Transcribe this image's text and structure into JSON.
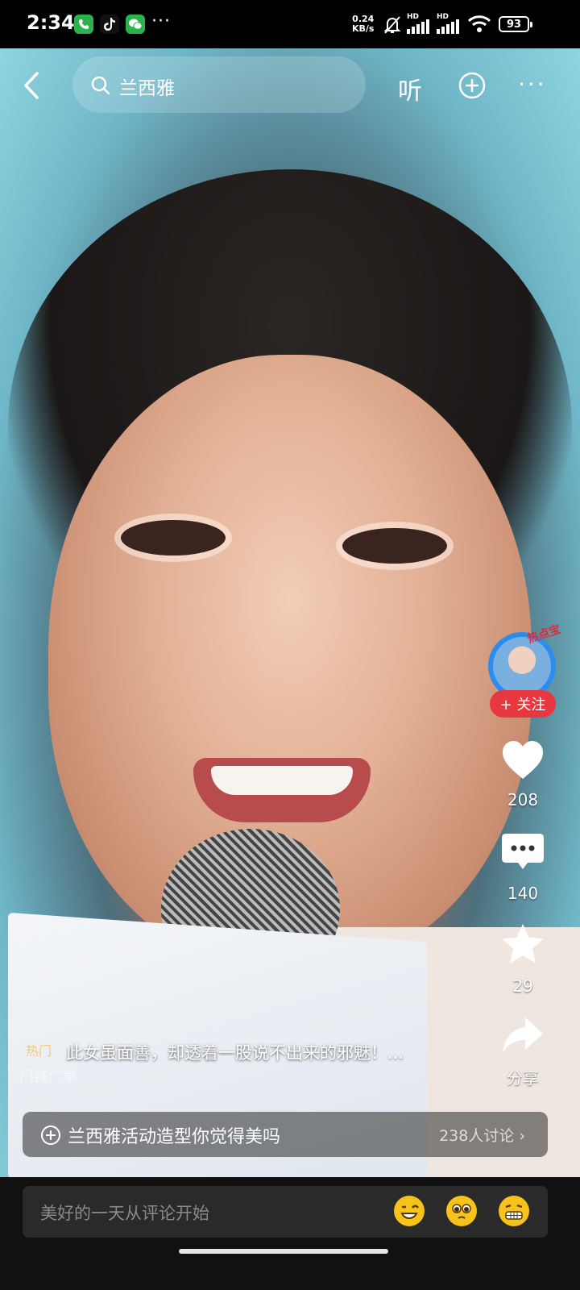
{
  "status_bar": {
    "time": "2:34",
    "more_glyph": "···",
    "net_speed_value": "0.24",
    "net_speed_unit": "KB/s",
    "hd_label_1": "HD",
    "hd_label_2": "HD",
    "battery": "93",
    "icons": [
      "phone-icon",
      "tiktok-icon",
      "wechat-icon",
      "mute-bell-icon",
      "signal-icon",
      "signal-icon",
      "wifi-icon",
      "battery-icon"
    ]
  },
  "top_bar": {
    "search_text": "兰西雅",
    "listen_label": "听",
    "more_glyph": "···"
  },
  "right_rail": {
    "avatar_badge": "热点宝",
    "follow_label": "+ 关注",
    "like_count": "208",
    "comment_count": "140",
    "favorite_count": "29",
    "share_label": "分享"
  },
  "caption": {
    "tag": "热门",
    "text": "此女虽面善，却透着一股说不出来的邪魅！...",
    "faint_text": "门锋广草"
  },
  "topic": {
    "title": "兰西雅活动造型你觉得美吗",
    "count": "238人讨论 ›"
  },
  "comment_bar": {
    "placeholder": "美好的一天从评论开始",
    "emojis": [
      "grinning-wink-emoji",
      "pleading-emoji",
      "grimace-emoji"
    ]
  },
  "colors": {
    "follow_red": "#e8373f",
    "avatar_ring": "#2b8df0"
  }
}
